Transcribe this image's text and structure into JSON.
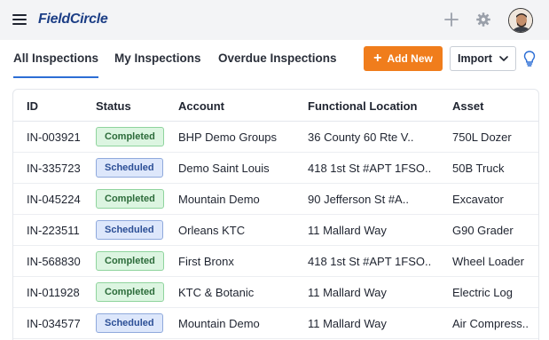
{
  "app": {
    "logo": "FieldCircle"
  },
  "tabs": [
    {
      "label": "All Inspections",
      "active": true
    },
    {
      "label": "My Inspections",
      "active": false
    },
    {
      "label": "Overdue Inspections",
      "active": false
    }
  ],
  "actions": {
    "add_new": "Add New",
    "import": "Import"
  },
  "table": {
    "headers": [
      "ID",
      "Status",
      "Account",
      "Functional Location",
      "Asset"
    ],
    "rows": [
      {
        "id": "IN-003921",
        "status": "Completed",
        "account": "BHP Demo Groups",
        "location": "36 County 60 Rte V..",
        "asset": "750L Dozer"
      },
      {
        "id": "IN-335723",
        "status": "Scheduled",
        "account": "Demo Saint Louis",
        "location": "418 1st St #APT 1FSO..",
        "asset": "50B Truck"
      },
      {
        "id": "IN-045224",
        "status": "Completed",
        "account": "Mountain Demo",
        "location": "90 Jefferson St #A..",
        "asset": "Excavator"
      },
      {
        "id": "IN-223511",
        "status": "Scheduled",
        "account": "Orleans KTC",
        "location": "11 Mallard Way",
        "asset": "G90 Grader"
      },
      {
        "id": "IN-568830",
        "status": "Completed",
        "account": "First Bronx",
        "location": "418 1st St #APT 1FSO..",
        "asset": "Wheel Loader"
      },
      {
        "id": "IN-011928",
        "status": "Completed",
        "account": "KTC & Botanic",
        "location": "11 Mallard Way",
        "asset": "Electric Log"
      },
      {
        "id": "IN-034577",
        "status": "Scheduled",
        "account": "Mountain Demo",
        "location": "11 Mallard Way",
        "asset": "Air Compress.."
      }
    ]
  },
  "colors": {
    "accent": "#2c6ed5",
    "add_button": "#f07d1c",
    "completed": "#dcf5e1",
    "scheduled": "#dde7fb"
  },
  "icons": {
    "menu": "hamburger-icon",
    "add": "plus-icon",
    "settings": "gear-icon",
    "import": "chevron-down-icon",
    "help": "lightbulb-icon"
  }
}
